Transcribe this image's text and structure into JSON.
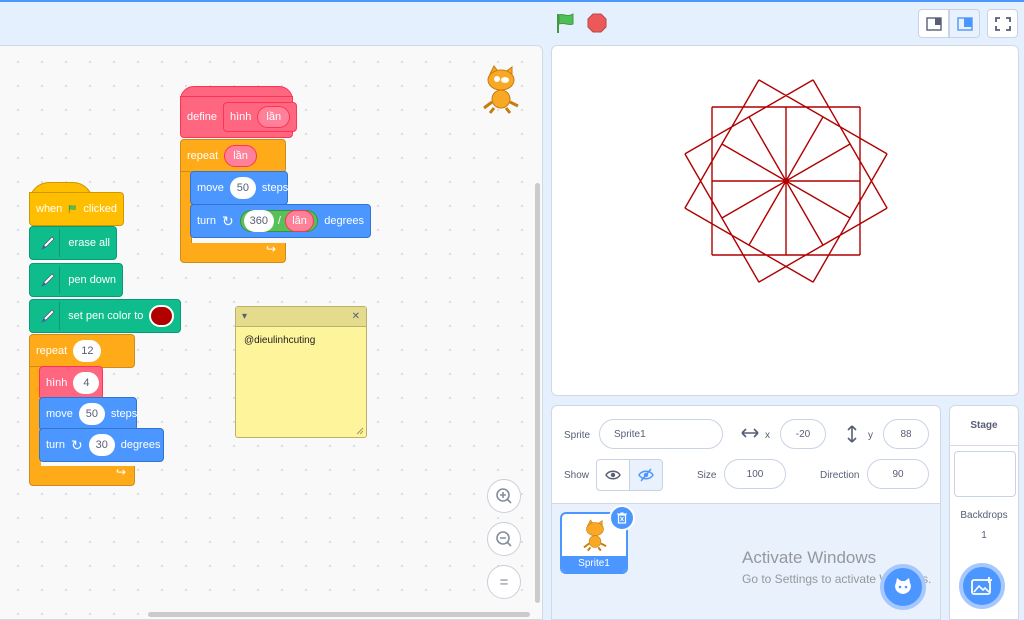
{
  "toolbar": {
    "green_flag_icon": "green-flag",
    "stop_icon": "stop-sign",
    "layout_modes": [
      "small-stage",
      "normal-stage",
      "full-screen"
    ]
  },
  "scripts": {
    "main": {
      "hat_when": "when",
      "hat_clicked": "clicked",
      "erase_all": "erase all",
      "pen_down": "pen down",
      "set_pen_color": "set pen color to",
      "pen_color": "#b00000",
      "repeat_label": "repeat",
      "repeat_count": "12",
      "hinh_label": "hình",
      "hinh_arg": "4",
      "move_label": "move",
      "move_steps": "50",
      "steps_label": "steps",
      "turn_label": "turn",
      "turn_degrees": "30",
      "degrees_label": "degrees"
    },
    "define": {
      "define_label": "define",
      "proc_name": "hình",
      "proc_param": "lần",
      "repeat_label": "repeat",
      "repeat_param": "lần",
      "move_label": "move",
      "move_steps": "50",
      "steps_label": "steps",
      "turn_label": "turn",
      "div_left": "360",
      "div_op": "/",
      "div_right": "lần",
      "degrees_label": "degrees"
    }
  },
  "comment": {
    "text": "@dieulinhcuting"
  },
  "zoom": {
    "zoom_in": "+",
    "zoom_out": "−",
    "reset": "="
  },
  "sprite_info": {
    "sprite_label": "Sprite",
    "sprite_name": "Sprite1",
    "x_label": "x",
    "x_value": "-20",
    "y_label": "y",
    "y_value": "88",
    "show_label": "Show",
    "size_label": "Size",
    "size_value": "100",
    "direction_label": "Direction",
    "direction_value": "90"
  },
  "sprite_list": [
    {
      "name": "Sprite1"
    }
  ],
  "stage_panel": {
    "title": "Stage",
    "backdrops_label": "Backdrops",
    "backdrops_count": "1"
  },
  "watermark": {
    "line1": "Activate Windows",
    "line2": "Go to Settings to activate Windows."
  },
  "colors": {
    "motion": "#4c97ff",
    "control": "#ffab19",
    "events": "#ffbf00",
    "pen": "#0fbd8c",
    "my_blocks": "#ff6680",
    "drawing": "#b00000"
  }
}
